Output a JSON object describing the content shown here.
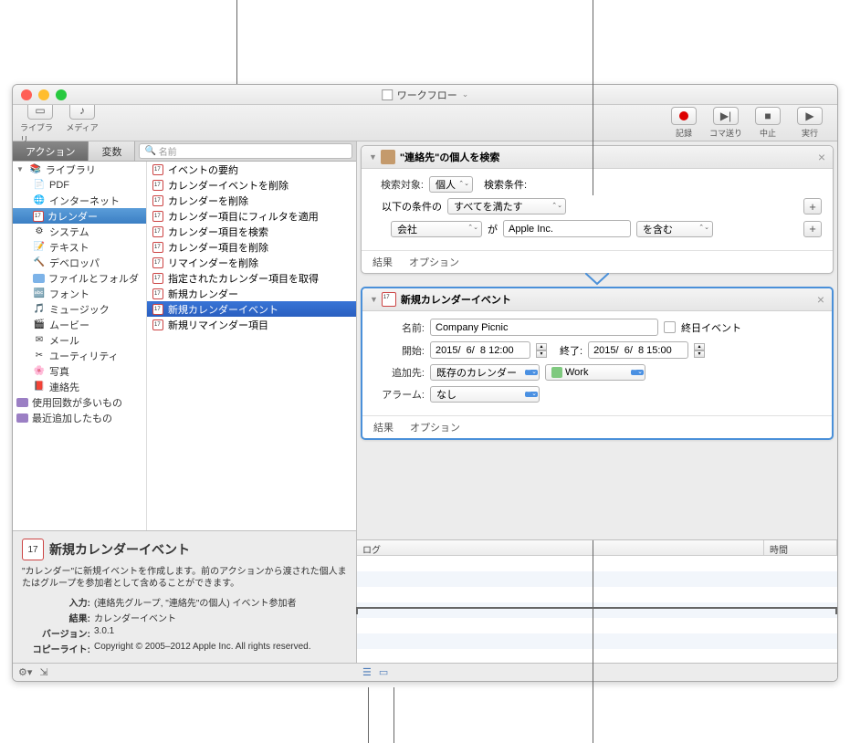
{
  "window": {
    "title": "ワークフロー"
  },
  "toolbar": {
    "library": "ライブラリ",
    "media": "メディア",
    "record": "記録",
    "step": "コマ送り",
    "stop": "中止",
    "run": "実行"
  },
  "tabs": {
    "action": "アクション",
    "variable": "変数"
  },
  "search": {
    "placeholder": "名前"
  },
  "library": {
    "root": "ライブラリ",
    "items": [
      "PDF",
      "インターネット",
      "カレンダー",
      "システム",
      "テキスト",
      "デベロッパ",
      "ファイルとフォルダ",
      "フォント",
      "ミュージック",
      "ムービー",
      "メール",
      "ユーティリティ",
      "写真",
      "連絡先"
    ],
    "extra1": "使用回数が多いもの",
    "extra2": "最近追加したもの"
  },
  "actions": [
    "イベントの要約",
    "カレンダーイベントを削除",
    "カレンダーを削除",
    "カレンダー項目にフィルタを適用",
    "カレンダー項目を検索",
    "カレンダー項目を削除",
    "リマインダーを削除",
    "指定されたカレンダー項目を取得",
    "新規カレンダー",
    "新規カレンダーイベント",
    "新規リマインダー項目"
  ],
  "info": {
    "title": "新規カレンダーイベント",
    "desc": "\"カレンダー\"に新規イベントを作成します。前のアクションから渡された個人またはグループを参加者として含めることができます。",
    "input_label": "入力:",
    "input_val": "(連絡先グループ, \"連絡先\"の個人) イベント参加者",
    "result_label": "結果:",
    "result_val": "カレンダーイベント",
    "version_label": "バージョン:",
    "version_val": "3.0.1",
    "copyright_label": "コピーライト:",
    "copyright_val": "Copyright © 2005–2012 Apple Inc.  All rights reserved."
  },
  "card1": {
    "title": "\"連絡先\"の個人を検索",
    "search_target_label": "検索対象:",
    "search_target": "個人",
    "search_cond_label": "検索条件:",
    "cond_prefix": "以下の条件の",
    "cond_match": "すべてを満たす",
    "field": "会社",
    "op": "が",
    "value": "Apple Inc.",
    "contains": "を含む",
    "results": "結果",
    "options": "オプション"
  },
  "card2": {
    "title": "新規カレンダーイベント",
    "name_label": "名前:",
    "name_val": "Company Picnic",
    "allday": "終日イベント",
    "start_label": "開始:",
    "start_val": "2015/  6/  8 12:00",
    "end_label": "終了:",
    "end_val": "2015/  6/  8 15:00",
    "addto_label": "追加先:",
    "addto_val": "既存のカレンダー",
    "cal_name": "Work",
    "alarm_label": "アラーム:",
    "alarm_val": "なし",
    "results": "結果",
    "options": "オプション"
  },
  "log": {
    "col1": "ログ",
    "col2": "時間"
  }
}
